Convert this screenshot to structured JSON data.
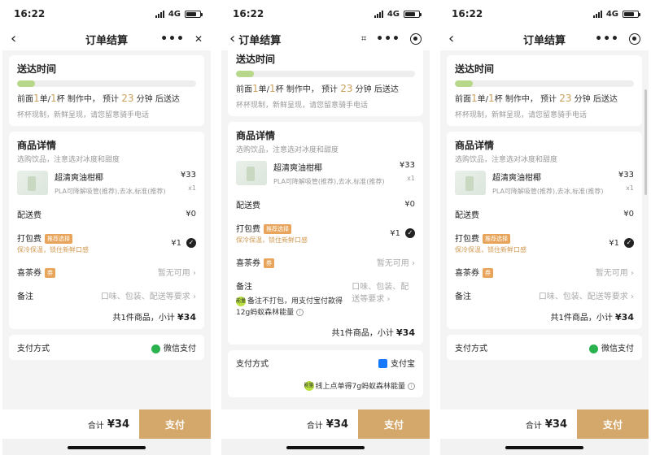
{
  "status": {
    "time": "16:22",
    "network": "4G"
  },
  "nav": {
    "title": "订单结算",
    "back": "‹",
    "dots": "•••",
    "close": "✕",
    "qr": "⌗"
  },
  "delivery": {
    "title": "送达时间",
    "progress": 0.1,
    "queue_prefix": "前面",
    "orders": "1",
    "orders_unit": "单/",
    "cups": "1",
    "cups_unit": "杯 制作中，  预计",
    "minutes": "23",
    "minutes_unit": "分钟 后送达",
    "note": "杯杯现制，新鲜呈现，请您留意骑手电话"
  },
  "goods": {
    "title": "商品详情",
    "subtitle": "选购饮品，注意选对冰度和甜度",
    "product": {
      "name": "超清爽油柑椰",
      "spec": "PLA可降解吸管(推荐),去冰,标准(推荐)",
      "price": "¥33",
      "qty": "x1"
    },
    "delivery_fee_label": "配送费",
    "delivery_fee": "¥0",
    "packing_label": "打包费",
    "packing_tag": "推荐选择",
    "packing_sub": "保冷保温，锁住新鲜口感",
    "packing_fee": "¥1",
    "coupon_label": "喜茶券",
    "coupon_tag": "券",
    "coupon_value": "暂无可用 ›",
    "remark_label": "备注",
    "remark_value": "口味、包装、配送等要求 ›",
    "remark_alipay_badge": "能量",
    "remark_alipay_note": "备注不打包，用支付宝付款得12g蚂蚁森林能量",
    "total_prefix": "共1件商品，小计",
    "total": "¥34"
  },
  "payment": {
    "label": "支付方式",
    "wechat": "微信支付",
    "alipay": "支付宝",
    "alipay_badge": "能量",
    "alipay_note": "线上点单得7g蚂蚁森林能量"
  },
  "bottom": {
    "total_label": "合计",
    "total": "¥34",
    "pay": "支付"
  },
  "colors": {
    "accent": "#d4a76a",
    "gold_text": "#caa05c",
    "progress": "#b7d88a",
    "wechat": "#2ab24f",
    "alipay": "#1677ff"
  },
  "icons": [
    "back-arrow-icon",
    "more-dots-icon",
    "close-icon",
    "qr-scan-icon",
    "target-circle-icon",
    "check-icon",
    "wechat-pay-icon",
    "alipay-icon",
    "info-icon"
  ]
}
